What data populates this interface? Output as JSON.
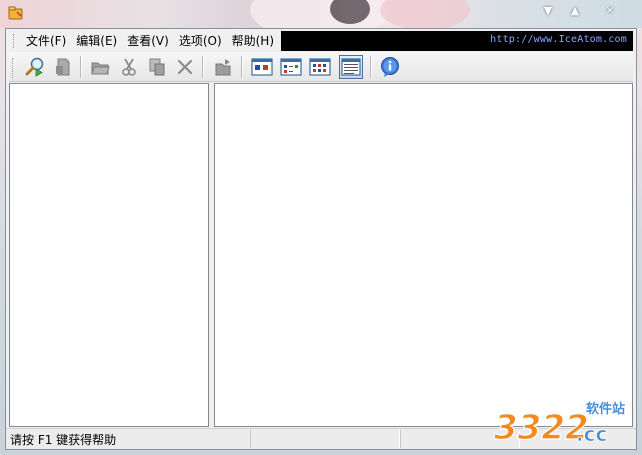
{
  "window": {
    "url_text": "http://www.IceAtom.com"
  },
  "caption": {
    "minimize": "▼",
    "maximize": "▲",
    "close": "✕"
  },
  "menu": [
    {
      "label": "文件(F)"
    },
    {
      "label": "编辑(E)"
    },
    {
      "label": "查看(V)"
    },
    {
      "label": "选项(O)"
    },
    {
      "label": "帮助(H)"
    }
  ],
  "toolbar": {
    "buttons": [
      {
        "icon": "search-magnifier-icon",
        "enabled": true
      },
      {
        "icon": "document-icon",
        "enabled": false
      },
      {
        "icon": "folder-open-icon",
        "enabled": false
      },
      {
        "icon": "scissors-icon",
        "enabled": false
      },
      {
        "icon": "copy-icon",
        "enabled": false
      },
      {
        "icon": "delete-x-icon",
        "enabled": false
      },
      {
        "icon": "export-icon",
        "enabled": false
      },
      {
        "icon": "view-large-icons-icon",
        "enabled": true
      },
      {
        "icon": "view-small-icons-icon",
        "enabled": true
      },
      {
        "icon": "view-list-icon",
        "enabled": true
      },
      {
        "icon": "view-details-icon",
        "enabled": true,
        "selected": true
      },
      {
        "icon": "info-icon",
        "enabled": true
      }
    ]
  },
  "status": {
    "hint": "请按 F1 键获得帮助"
  },
  "watermark": {
    "number": "3322",
    "suffix": ".cc",
    "site": "软件站"
  },
  "colors": {
    "menubar_black": "#000000",
    "url_blue": "#8aa8ff",
    "watermark_orange": "#f28a1e",
    "watermark_blue": "#4a8fd6"
  }
}
